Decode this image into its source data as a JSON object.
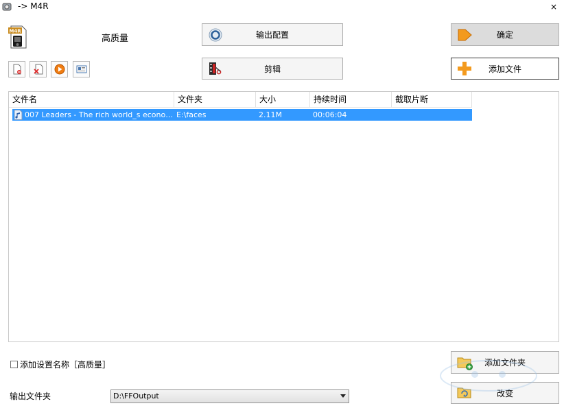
{
  "window": {
    "title": "-> M4R",
    "close_glyph": "×"
  },
  "preset": {
    "icon_label": "M4R",
    "name": "高质量"
  },
  "buttons": {
    "output_config": "输出配置",
    "edit": "剪辑",
    "confirm": "确定",
    "add_file": "添加文件",
    "add_folder": "添加文件夹",
    "change": "改变"
  },
  "toolbar": {
    "icons": [
      "remove-file-icon",
      "delete-icon",
      "play-icon",
      "info-icon"
    ]
  },
  "file_list": {
    "columns": [
      "文件名",
      "文件夹",
      "大小",
      "持续时间",
      "截取片断"
    ],
    "rows": [
      {
        "name": "007 Leaders - The rich world_s economy....",
        "folder": "E:\\faces",
        "size": "2.11M",
        "duration": "00:06:04",
        "clip": ""
      }
    ]
  },
  "bottom": {
    "add_preset_name": "添加设置名称［高质量］",
    "add_preset_checked": false,
    "output_folder_label": "输出文件夹",
    "output_folder_value": "D:\\FFOutput"
  },
  "colors": {
    "selection": "#3399ff",
    "confirm_bg": "#dcdcdc",
    "accent_orange": "#f39a1e"
  }
}
